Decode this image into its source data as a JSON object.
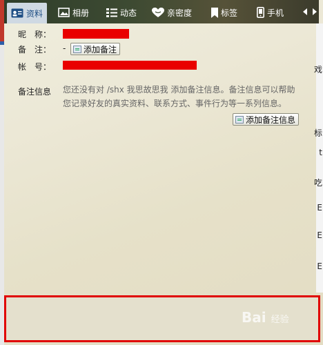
{
  "tabs": [
    {
      "label": "资料",
      "icon": "id-card-icon",
      "active": true
    },
    {
      "label": "相册",
      "icon": "photo-icon",
      "active": false
    },
    {
      "label": "动态",
      "icon": "list-icon",
      "active": false
    },
    {
      "label": "亲密度",
      "icon": "heart-icon",
      "active": false
    },
    {
      "label": "标签",
      "icon": "bookmark-icon",
      "active": false
    },
    {
      "label": "手机",
      "icon": "phone-icon",
      "active": false
    }
  ],
  "profile": {
    "nickname_label": "昵　称：",
    "remark_label": "备　注：",
    "remark_value": "-",
    "add_remark_label": "添加备注",
    "account_label": "帐　号："
  },
  "remark_info": {
    "label": "备注信息",
    "text_line1": "您还没有对 /shx 我思故思我  添加备注信息。备注信息可以帮助",
    "text_line2": "您记录好友的真实资料、联系方式、事件行为等一系列信息。",
    "button_label": "添加备注信息"
  },
  "right_edge_chars": [
    "戏",
    "标",
    "t",
    "吃",
    "E",
    "E",
    "E"
  ],
  "watermark": {
    "text": "Bai",
    "suffix": "经验"
  },
  "colors": {
    "redaction": "#e90000",
    "active_tab": "#cfd9e3",
    "highlight_border": "#e00000"
  }
}
